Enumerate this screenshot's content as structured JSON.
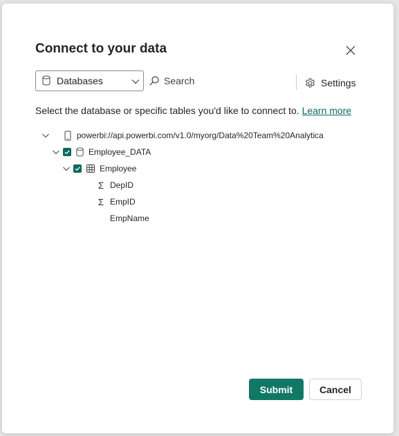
{
  "dialog": {
    "title": "Connect to your data"
  },
  "toolbar": {
    "source_select_value": "Databases",
    "search_label": "Search",
    "settings_label": "Settings"
  },
  "description": {
    "text": "Select the database or specific tables you'd like to connect to.",
    "link": "Learn more"
  },
  "tree": {
    "root": {
      "label": "powerbi://api.powerbi.com/v1.0/myorg/Data%20Team%20Analytica",
      "icon": "device-icon",
      "expanded": true
    },
    "database": {
      "label": "Employee_DATA",
      "icon": "database-icon",
      "checked": true,
      "expanded": true
    },
    "table": {
      "label": "Employee",
      "icon": "table-icon",
      "checked": true,
      "expanded": true
    },
    "columns": [
      {
        "label": "DepID",
        "icon": "sigma-icon"
      },
      {
        "label": "EmpID",
        "icon": "sigma-icon"
      },
      {
        "label": "EmpName",
        "icon": ""
      }
    ]
  },
  "footer": {
    "submit_label": "Submit",
    "cancel_label": "Cancel"
  },
  "colors": {
    "accent": "#117865",
    "link": "#0b6a5f",
    "text": "#242424"
  }
}
